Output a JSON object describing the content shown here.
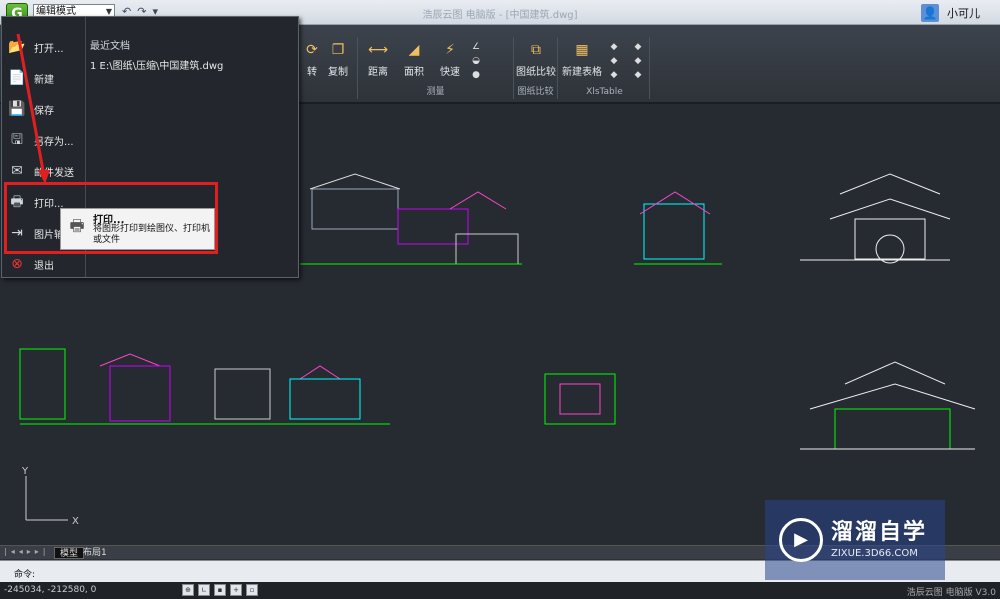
{
  "app": {
    "title": "浩辰云图 电脑版 - [中国建筑.dwg]",
    "logo_letter": "G",
    "mode": "编辑模式"
  },
  "user": {
    "name": "小可儿"
  },
  "ribbon": {
    "tools": [
      {
        "label": "转",
        "icon": "rotate-icon"
      },
      {
        "label": "复制",
        "icon": "copy-icon"
      },
      {
        "label": "距离",
        "icon": "distance-icon"
      },
      {
        "label": "面积",
        "icon": "area-icon"
      },
      {
        "label": "快速",
        "icon": "quick-measure-icon"
      },
      {
        "label": "图纸比较",
        "icon": "compare-icon"
      },
      {
        "label": "新建表格",
        "icon": "table-icon"
      }
    ],
    "groups": [
      "测量",
      "图纸比较",
      "XlsTable"
    ]
  },
  "menu": {
    "items": [
      "打开...",
      "新建",
      "保存",
      "另存为...",
      "邮件发送",
      "打印...",
      "图片输出",
      "退出"
    ],
    "recent_title": "最近文档",
    "recent_item": "1 E:\\图纸\\压缩\\中国建筑.dwg"
  },
  "tooltip": {
    "title": "打印...",
    "desc": "将图形打印到绘图仪、打印机或文件"
  },
  "canvas": {
    "ucs_y": "Y",
    "ucs_x": "X"
  },
  "tabs": {
    "model": "模型",
    "layout": "布局1"
  },
  "cmd": {
    "label": "命令:"
  },
  "status": {
    "coords": "-245034, -212580, 0",
    "version": "浩辰云图 电脑版 V3.0"
  },
  "watermark": {
    "name": "溜溜自学",
    "url": "ZIXUE.3D66.COM"
  },
  "colors": {
    "highlight": "#e02020",
    "canvas": "#262a31"
  }
}
